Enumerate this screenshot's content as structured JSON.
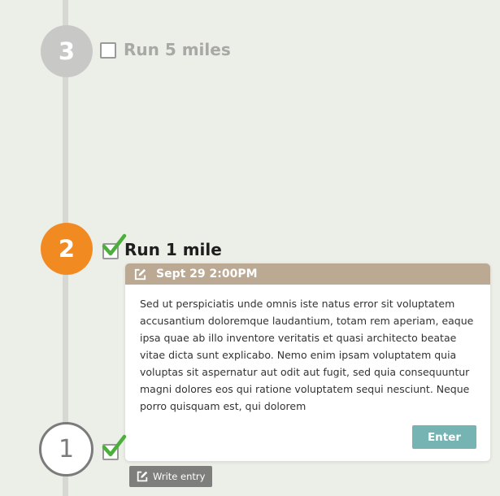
{
  "colors": {
    "background": "#eceee8",
    "timeline_line": "#d7d8d4",
    "step_pending": "#c8c8c6",
    "step_current": "#f28a22",
    "step_outline": "#7b7b7b",
    "checkmark": "#4caf3c",
    "entry_header": "#bba994",
    "enter_button": "#76b4b4",
    "write_entry_button": "#7e7e7c"
  },
  "steps": [
    {
      "number": "3",
      "label": "Run 5 miles",
      "checked": false,
      "state": "pending"
    },
    {
      "number": "2",
      "label": "Run 1 mile",
      "checked": true,
      "state": "current"
    },
    {
      "number": "1",
      "label": "",
      "checked": true,
      "state": "completed"
    }
  ],
  "entry": {
    "icon": "edit-icon",
    "date": "Sept 29 2:00PM",
    "text": "Sed ut perspiciatis unde omnis iste natus error sit voluptatem accusantium doloremque laudantium, totam rem aperiam, eaque ipsa quae ab illo inventore veritatis et quasi architecto beatae vitae dicta sunt explicabo. Nemo enim ipsam voluptatem quia voluptas sit aspernatur aut odit aut fugit, sed quia consequuntur magni dolores eos qui ratione voluptatem sequi nesciunt. Neque porro quisquam est, qui dolorem",
    "enter_label": "Enter"
  },
  "write_entry": {
    "icon": "edit-icon",
    "label": "Write entry"
  }
}
